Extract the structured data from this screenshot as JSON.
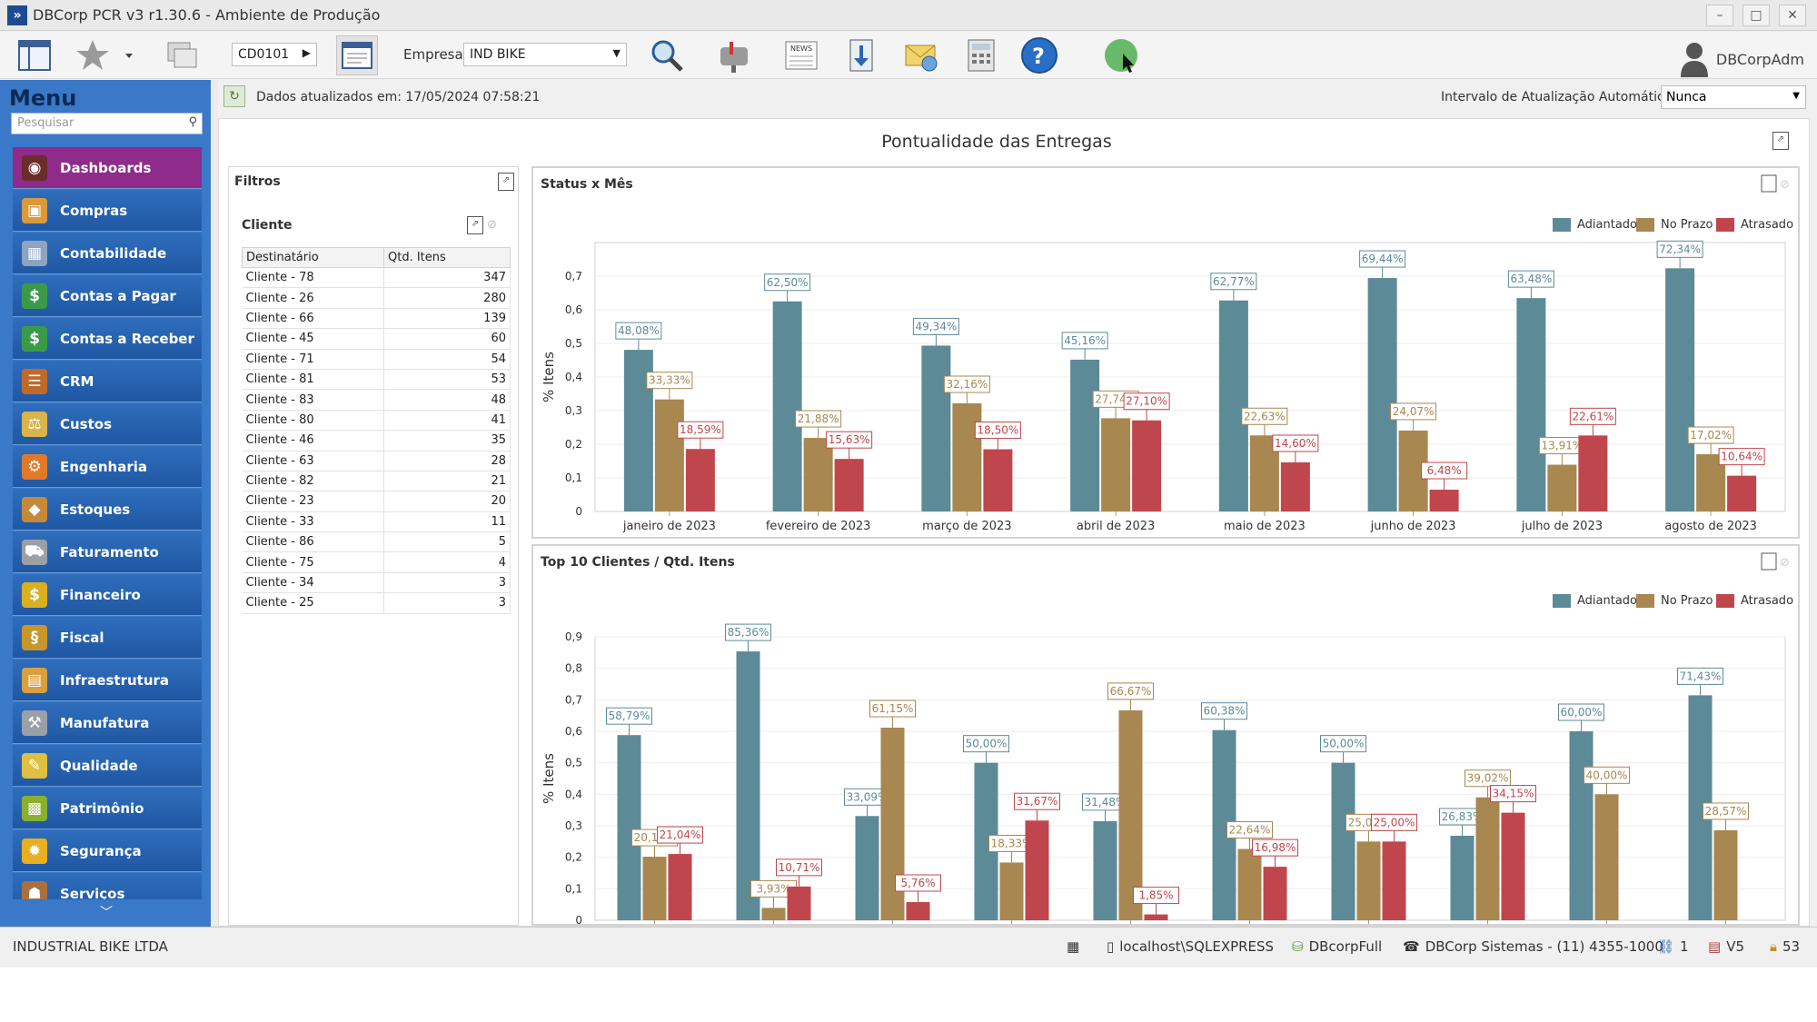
{
  "window": {
    "title": "DBCorp PCR v3 r1.30.6 - Ambiente de Produção",
    "app_glyph": "»"
  },
  "toolbar": {
    "code": "CD0101",
    "empresa_label": "Empresa",
    "empresa_value": "IND BIKE",
    "user": "DBCorpAdm"
  },
  "sidebar": {
    "title": "Menu",
    "search_placeholder": "Pesquisar",
    "items": [
      {
        "label": "Dashboards",
        "icon": "dashboard-icon"
      },
      {
        "label": "Compras",
        "icon": "box-icon"
      },
      {
        "label": "Contabilidade",
        "icon": "calculator-icon"
      },
      {
        "label": "Contas a Pagar",
        "icon": "money-minus-icon"
      },
      {
        "label": "Contas a Receber",
        "icon": "money-plus-icon"
      },
      {
        "label": "CRM",
        "icon": "crm-icon"
      },
      {
        "label": "Custos",
        "icon": "scale-icon"
      },
      {
        "label": "Engenharia",
        "icon": "gears-icon"
      },
      {
        "label": "Estoques",
        "icon": "stock-icon"
      },
      {
        "label": "Faturamento",
        "icon": "cart-icon"
      },
      {
        "label": "Financeiro",
        "icon": "finance-icon"
      },
      {
        "label": "Fiscal",
        "icon": "fiscal-icon"
      },
      {
        "label": "Infraestrutura",
        "icon": "infra-icon"
      },
      {
        "label": "Manufatura",
        "icon": "tools-icon"
      },
      {
        "label": "Qualidade",
        "icon": "quality-icon"
      },
      {
        "label": "Patrimônio",
        "icon": "assets-icon"
      },
      {
        "label": "Segurança",
        "icon": "lock-icon"
      },
      {
        "label": "Serviços",
        "icon": "services-icon"
      }
    ]
  },
  "infobar": {
    "updated_text": "Dados atualizados em: 17/05/2024 07:58:21",
    "interval_label": "Intervalo de Atualização Automática:",
    "interval_value": "Nunca"
  },
  "dashboard": {
    "title": "Pontualidade das Entregas",
    "filters_title": "Filtros",
    "cliente_title": "Cliente",
    "columns": [
      "Destinatário",
      "Qtd. Itens"
    ],
    "rows": [
      [
        "Cliente - 78",
        "347"
      ],
      [
        "Cliente - 26",
        "280"
      ],
      [
        "Cliente - 66",
        "139"
      ],
      [
        "Cliente - 45",
        "60"
      ],
      [
        "Cliente - 71",
        "54"
      ],
      [
        "Cliente - 81",
        "53"
      ],
      [
        "Cliente - 83",
        "48"
      ],
      [
        "Cliente - 80",
        "41"
      ],
      [
        "Cliente - 46",
        "35"
      ],
      [
        "Cliente - 63",
        "28"
      ],
      [
        "Cliente - 82",
        "21"
      ],
      [
        "Cliente - 23",
        "20"
      ],
      [
        "Cliente - 33",
        "11"
      ],
      [
        "Cliente - 86",
        "5"
      ],
      [
        "Cliente - 75",
        "4"
      ],
      [
        "Cliente - 34",
        "3"
      ],
      [
        "Cliente - 25",
        "3"
      ]
    ]
  },
  "colors": {
    "adiantado": "#5d8a97",
    "no_prazo": "#a88750",
    "atrasado": "#c0464e"
  },
  "chart_data": [
    {
      "type": "bar",
      "title": "Status x Mês",
      "ylabel": "% Itens",
      "ylim": [
        0,
        0.8
      ],
      "yticks": [
        "0",
        "0,1",
        "0,2",
        "0,3",
        "0,4",
        "0,5",
        "0,6",
        "0,7"
      ],
      "legend": "top-right",
      "categories": [
        "janeiro de 2023",
        "fevereiro de 2023",
        "março de 2023",
        "abril de 2023",
        "maio de 2023",
        "junho de 2023",
        "julho de 2023",
        "agosto de 2023"
      ],
      "series": [
        {
          "name": "Adiantado",
          "values": [
            0.4808,
            0.625,
            0.4934,
            0.4516,
            0.6277,
            0.6944,
            0.6348,
            0.7234
          ],
          "labels": [
            "48,08%",
            "62,50%",
            "49,34%",
            "45,16%",
            "62,77%",
            "69,44%",
            "63,48%",
            "72,34%"
          ]
        },
        {
          "name": "No Prazo",
          "values": [
            0.3333,
            0.2188,
            0.3216,
            0.2774,
            0.2263,
            0.2407,
            0.1391,
            0.1702
          ],
          "labels": [
            "33,33%",
            "21,88%",
            "32,16%",
            "27,74%",
            "22,63%",
            "24,07%",
            "13,91%",
            "17,02%"
          ]
        },
        {
          "name": "Atrasado",
          "values": [
            0.1859,
            0.1563,
            0.185,
            0.271,
            0.146,
            0.0648,
            0.2261,
            0.1064
          ],
          "labels": [
            "18,59%",
            "15,63%",
            "18,50%",
            "27,10%",
            "14,60%",
            "6,48%",
            "22,61%",
            "10,64%"
          ]
        }
      ]
    },
    {
      "type": "bar",
      "title": "Top 10 Clientes / Qtd. Itens",
      "ylabel": "% Itens",
      "ylim": [
        0,
        0.9
      ],
      "yticks": [
        "0",
        "0,1",
        "0,2",
        "0,3",
        "0,4",
        "0,5",
        "0,6",
        "0,7",
        "0,8",
        "0,9"
      ],
      "legend": "top-right",
      "categories": [
        "",
        "",
        "",
        "",
        "",
        "",
        "",
        "",
        "",
        ""
      ],
      "series": [
        {
          "name": "Adiantado",
          "values": [
            0.5879,
            0.8536,
            0.3309,
            0.5,
            0.3148,
            0.6038,
            0.5,
            0.2683,
            0.6,
            0.7143
          ],
          "labels": [
            "58,79%",
            "85,36%",
            "33,09%",
            "50,00%",
            "31,48%",
            "60,38%",
            "50,00%",
            "26,83%",
            "60,00%",
            "71,43%"
          ]
        },
        {
          "name": "No Prazo",
          "values": [
            0.2017,
            0.0393,
            0.6115,
            0.1833,
            0.6667,
            0.2264,
            0.25,
            0.3902,
            0.4,
            0.2857
          ],
          "labels": [
            "20,17%",
            "3,93%",
            "61,15%",
            "18,33%",
            "66,67%",
            "22,64%",
            "25,00%",
            "39,02%",
            "40,00%",
            "28,57%"
          ]
        },
        {
          "name": "Atrasado",
          "values": [
            0.2104,
            0.1071,
            0.0576,
            0.3167,
            0.0185,
            0.1698,
            0.25,
            0.3415,
            null,
            null
          ],
          "labels": [
            "21,04%",
            "10,71%",
            "5,76%",
            "31,67%",
            "1,85%",
            "16,98%",
            "25,00%",
            "34,15%",
            "",
            ""
          ]
        }
      ]
    }
  ],
  "statusbar": {
    "company": "INDUSTRIAL BIKE LTDA",
    "server": "localhost\\SQLEXPRESS",
    "database": "DBcorpFull",
    "vendor": "DBCorp Sistemas - (11) 4355-1000",
    "count1": "1",
    "version": "V5",
    "count2": "53"
  }
}
